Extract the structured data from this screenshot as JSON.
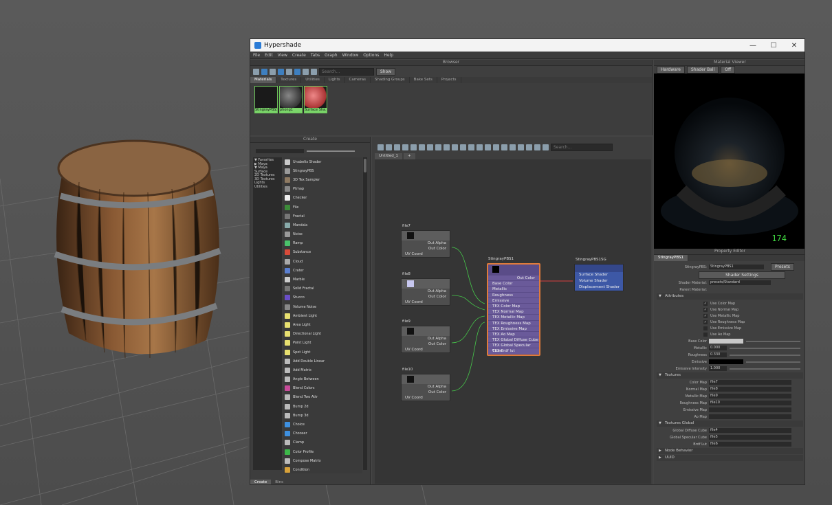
{
  "window": {
    "title": "Hypershade",
    "controls": [
      "—",
      "☐",
      "✕"
    ]
  },
  "menubar": [
    "File",
    "Edit",
    "View",
    "Create",
    "Tabs",
    "Graph",
    "Window",
    "Options",
    "Help"
  ],
  "browser": {
    "title": "Browser",
    "search_placeholder": "Search...",
    "show_label": "Show",
    "tabs": [
      "Materials",
      "Textures",
      "Utilities",
      "Lights",
      "Cameras",
      "Shading Groups",
      "Bake Sets",
      "Projects"
    ],
    "thumbs": [
      "StingrayPBS1",
      "phong1",
      "Surface Sha..."
    ]
  },
  "create": {
    "title": "Create",
    "tree": [
      "▼ Favorites",
      "  ▶ Maya",
      "▼ Maya",
      "   Surface",
      "   2D Textures",
      "   3D Textures",
      "   Lights",
      "   Utilities"
    ],
    "items": [
      {
        "label": "Unabelts Shader",
        "color": "#c9c9c9"
      },
      {
        "label": "StingrayPBS",
        "color": "#9a9a9a"
      },
      {
        "label": "3D Tex Sampler",
        "color": "#8e7a62"
      },
      {
        "label": "Ptmap",
        "color": "#888"
      },
      {
        "label": "Checker",
        "color": "#eeeeee"
      },
      {
        "label": "File",
        "color": "#3d8c3a"
      },
      {
        "label": "Fractal",
        "color": "#777"
      },
      {
        "label": "Mandala",
        "color": "#8aa"
      },
      {
        "label": "Noise",
        "color": "#999"
      },
      {
        "label": "Ramp",
        "color": "#4ac26b"
      },
      {
        "label": "Substance",
        "color": "#d84b3a"
      },
      {
        "label": "Cloud",
        "color": "#aaa"
      },
      {
        "label": "Crater",
        "color": "#5a7fd0"
      },
      {
        "label": "Marble",
        "color": "#ccc"
      },
      {
        "label": "Solid Fractal",
        "color": "#777"
      },
      {
        "label": "Stucco",
        "color": "#6a4ec8"
      },
      {
        "label": "Volume Noise",
        "color": "#888"
      },
      {
        "label": "Ambient Light",
        "color": "#e8e070"
      },
      {
        "label": "Area Light",
        "color": "#e8e070"
      },
      {
        "label": "Directional Light",
        "color": "#e8e070"
      },
      {
        "label": "Point Light",
        "color": "#e8e070"
      },
      {
        "label": "Spot Light",
        "color": "#e8e070"
      },
      {
        "label": "Add Double Linear",
        "color": "#bbb"
      },
      {
        "label": "Add Matrix",
        "color": "#bbb"
      },
      {
        "label": "Angle Between",
        "color": "#bbb"
      },
      {
        "label": "Blend Colors",
        "color": "#c84b9a"
      },
      {
        "label": "Blend Two Attr",
        "color": "#bbb"
      },
      {
        "label": "Bump 2d",
        "color": "#bbb"
      },
      {
        "label": "Bump 3d",
        "color": "#bbb"
      },
      {
        "label": "Choice",
        "color": "#3e90e0"
      },
      {
        "label": "Chooser",
        "color": "#3e90e0"
      },
      {
        "label": "Clamp",
        "color": "#bbb"
      },
      {
        "label": "Color Profile",
        "color": "#3db84a"
      },
      {
        "label": "Compose Matrix",
        "color": "#bbb"
      },
      {
        "label": "Condition",
        "color": "#d8a23a"
      }
    ],
    "bottom_tabs": [
      "Create",
      "Bins"
    ]
  },
  "graph": {
    "search_placeholder": "Search...",
    "tab": "Untitled_1",
    "add_tab": "+",
    "file_nodes": [
      {
        "name": "file7",
        "swatch": "#111111",
        "outputs": [
          "Out Alpha",
          "Out Color"
        ],
        "input": "UV Coord"
      },
      {
        "name": "file8",
        "swatch": "#c8c8f0",
        "outputs": [
          "Out Alpha",
          "Out Color"
        ],
        "input": "UV Coord"
      },
      {
        "name": "file9",
        "swatch": "#111111",
        "outputs": [
          "Out Alpha",
          "Out Color"
        ],
        "input": "UV Coord"
      },
      {
        "name": "file10",
        "swatch": "#111111",
        "outputs": [
          "Out Alpha",
          "Out Color"
        ],
        "input": "UV Coord"
      }
    ],
    "pbs": {
      "name": "StingrayPBS1",
      "out": "Out Color",
      "rows": [
        "Base Color",
        "Metallic",
        "Roughness",
        "Emissive",
        "TEX Color Map",
        "TEX Normal Map",
        "TEX Metallic Map",
        "TEX Roughness Map",
        "TEX Emissive Map",
        "TEX Ao Map",
        "TEX Global Diffuse Cube",
        "TEX Global Specular Cube",
        "TEX Brdf lut"
      ]
    },
    "sg": {
      "name": "StingrayPBS1SG",
      "rows": [
        "Surface Shader",
        "Volume Shader",
        "Displacement Shader"
      ]
    }
  },
  "material_viewer": {
    "title": "Material Viewer",
    "renderer": "Hardware",
    "ball": "Shader Ball",
    "env": "Off",
    "counter": "174"
  },
  "attribute_editor": {
    "title": "Property Editor",
    "tab": "StingrayPBS1",
    "type_label": "StingrayPBS:",
    "name": "StingrayPBS1",
    "presets": "Presets",
    "shader_btn": "Shader Settings",
    "shader_field_label": "Shader Material:",
    "shader_value": "presets/Standard",
    "parent_label": "Parent Material:",
    "sect_attributes": "Attributes",
    "checks": [
      {
        "label": "Use Color Map",
        "on": true
      },
      {
        "label": "Use Normal Map",
        "on": true
      },
      {
        "label": "Use Metallic Map",
        "on": true
      },
      {
        "label": "Use Roughness Map",
        "on": true
      },
      {
        "label": "Use Emissive Map",
        "on": false
      },
      {
        "label": "Use Ao Map",
        "on": false
      }
    ],
    "base_color": "Base Color",
    "metallic": {
      "label": "Metallic",
      "value": "0.000"
    },
    "roughness": {
      "label": "Roughness",
      "value": "0.330"
    },
    "emissive": "Emissive",
    "emissive_intensity": {
      "label": "Emissive Intensity",
      "value": "1.000"
    },
    "sect_textures": "Textures",
    "textures": [
      {
        "label": "Color Map",
        "value": "file7"
      },
      {
        "label": "Normal Map",
        "value": "file8"
      },
      {
        "label": "Metallic Map",
        "value": "file9"
      },
      {
        "label": "Roughness Map",
        "value": "file10"
      },
      {
        "label": "Emissive Map",
        "value": ""
      },
      {
        "label": "Ao Map",
        "value": ""
      }
    ],
    "sect_textures_global": "Textures Global",
    "globals": [
      {
        "label": "Global Diffuse Cube",
        "value": "file4"
      },
      {
        "label": "Global Specular Cube",
        "value": "file5"
      },
      {
        "label": "Brdf Lut",
        "value": "file6"
      }
    ],
    "sect_node_behavior": "Node Behavior",
    "sect_uuid": "UUID"
  }
}
